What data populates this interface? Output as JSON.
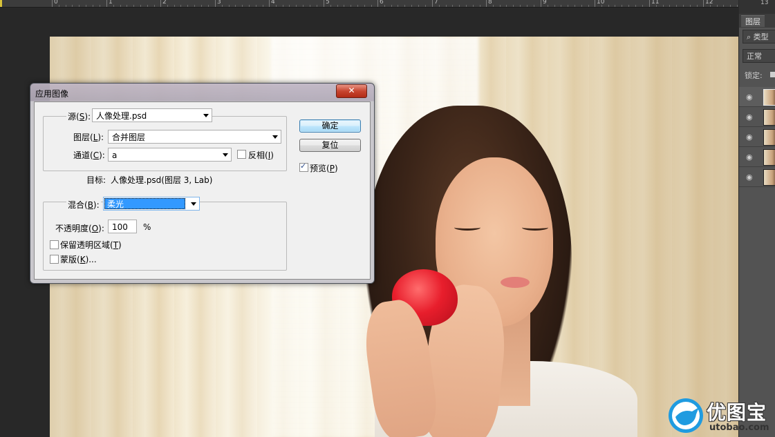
{
  "ruler": {
    "numbers": [
      "0",
      "1",
      "2",
      "3",
      "4",
      "5",
      "6",
      "7",
      "8",
      "9",
      "10",
      "11",
      "12"
    ],
    "extra_number": "13"
  },
  "dialog": {
    "title": "应用图像",
    "close_symbol": "✕",
    "source_label_pre": "源(",
    "source_label_key": "S",
    "source_label_post": "):",
    "source_value": "人像处理.psd",
    "layer_label_pre": "图层(",
    "layer_label_key": "L",
    "layer_label_post": "):",
    "layer_value": "合并图层",
    "channel_label_pre": "通道(",
    "channel_label_key": "C",
    "channel_label_post": "):",
    "channel_value": "a",
    "invert_label_pre": "反相(",
    "invert_label_key": "I",
    "invert_label_post": ")",
    "invert_checked": false,
    "target_label": "目标:",
    "target_value": "人像处理.psd(图层 3, Lab)",
    "blend_label_pre": "混合(",
    "blend_label_key": "B",
    "blend_label_post": "):",
    "blend_value": "柔光",
    "opacity_label_pre": "不透明度(",
    "opacity_label_key": "O",
    "opacity_label_post": "):",
    "opacity_value": "100",
    "opacity_unit": "%",
    "preserve_label_pre": "保留透明区域(",
    "preserve_label_key": "T",
    "preserve_label_post": ")",
    "preserve_checked": false,
    "mask_label_pre": "蒙版(",
    "mask_label_key": "K",
    "mask_label_post": ")...",
    "mask_checked": false,
    "ok_button": "确定",
    "reset_button": "复位",
    "preview_label_pre": "预览(",
    "preview_label_key": "P",
    "preview_label_post": ")",
    "preview_checked": true
  },
  "layers_panel": {
    "tab": "图层",
    "filter_label": "类型",
    "filter_icon": "search-icon",
    "blend_mode": "正常",
    "lock_label": "锁定:",
    "rows": [
      {
        "visible": true,
        "active": true
      },
      {
        "visible": true,
        "active": false
      },
      {
        "visible": true,
        "active": false
      },
      {
        "visible": true,
        "active": false
      },
      {
        "visible": true,
        "active": false
      }
    ]
  },
  "watermark": {
    "name": "优图宝",
    "url": "utobao.com"
  }
}
